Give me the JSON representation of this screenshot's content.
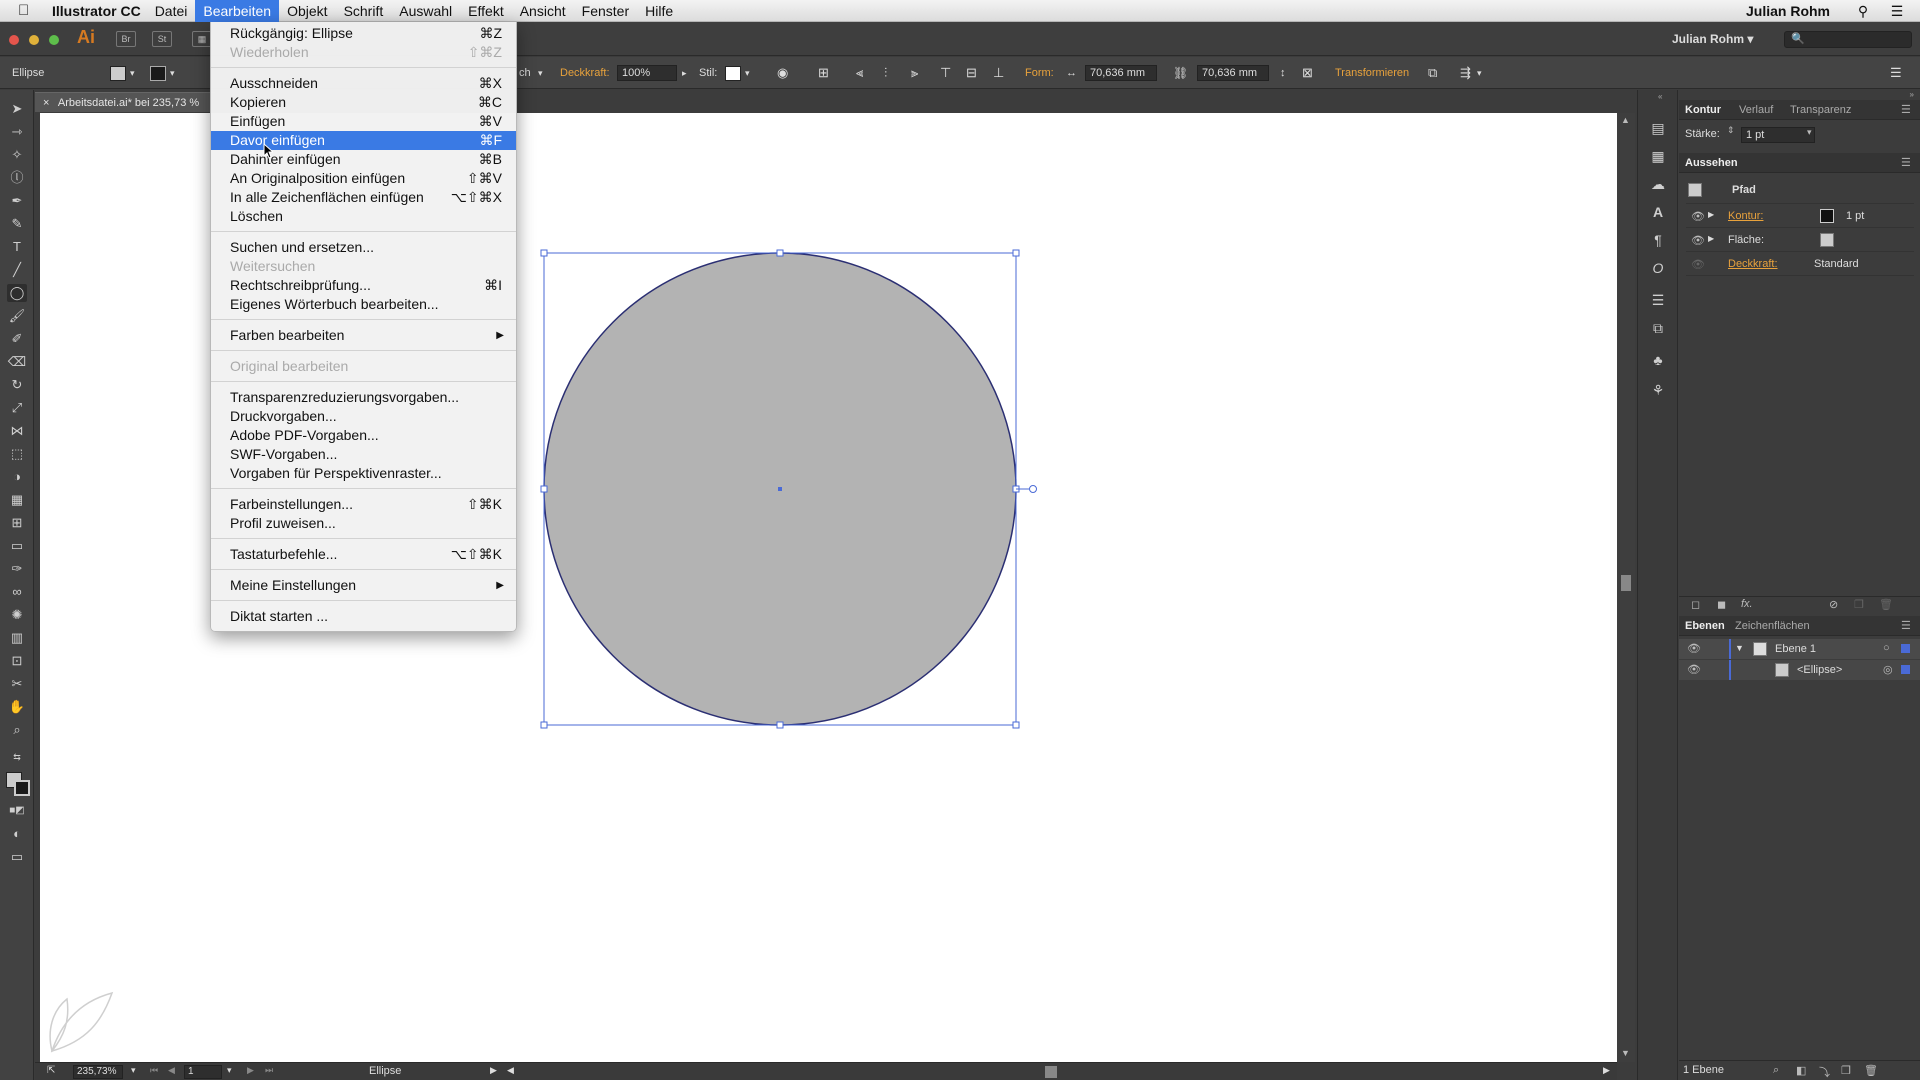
{
  "menubar": {
    "app_name": "Illustrator CC",
    "menus": [
      "Datei",
      "Bearbeiten",
      "Objekt",
      "Schrift",
      "Auswahl",
      "Effekt",
      "Ansicht",
      "Fenster",
      "Hilfe"
    ],
    "active_menu": "Bearbeiten",
    "user": "Julian Rohm"
  },
  "appbar": {
    "logo": "Ai",
    "bridge_labels": [
      "Br",
      "St"
    ],
    "user": "Julian Rohm",
    "user_caret": "▾",
    "search_placeholder": "🔍"
  },
  "controlbar": {
    "selection_label": "Ellipse",
    "partial_label": "ch",
    "opacity_label": "Deckkraft:",
    "opacity_value": "100%",
    "style_label": "Stil:",
    "form_label": "Form:",
    "width_value": "70,636 mm",
    "height_value": "70,636 mm",
    "transform_label": "Transformieren"
  },
  "document": {
    "tab_title": "Arbeitsdatei.ai* bei 235,73 %"
  },
  "dropdown": {
    "items": [
      {
        "label": "Rückgängig: Ellipse",
        "shortcut": "⌘Z",
        "disabled": false
      },
      {
        "label": "Wiederholen",
        "shortcut": "⇧⌘Z",
        "disabled": true
      },
      {
        "label": "Ausschneiden",
        "shortcut": "⌘X",
        "disabled": false
      },
      {
        "label": "Kopieren",
        "shortcut": "⌘C",
        "disabled": false
      },
      {
        "label": "Einfügen",
        "shortcut": "⌘V",
        "disabled": false
      },
      {
        "label": "Davor einfügen",
        "shortcut": "⌘F",
        "disabled": false,
        "highlighted": true
      },
      {
        "label": "Dahinter einfügen",
        "shortcut": "⌘B",
        "disabled": false
      },
      {
        "label": "An Originalposition einfügen",
        "shortcut": "⇧⌘V",
        "disabled": false
      },
      {
        "label": "In alle Zeichenflächen einfügen",
        "shortcut": "⌥⇧⌘X",
        "disabled": false
      },
      {
        "label": "Löschen",
        "shortcut": "",
        "disabled": false
      },
      {
        "label": "Suchen und ersetzen...",
        "shortcut": "",
        "disabled": false
      },
      {
        "label": "Weitersuchen",
        "shortcut": "",
        "disabled": true
      },
      {
        "label": "Rechtschreibprüfung...",
        "shortcut": "⌘I",
        "disabled": false
      },
      {
        "label": "Eigenes Wörterbuch bearbeiten...",
        "shortcut": "",
        "disabled": false
      },
      {
        "label": "Farben bearbeiten",
        "shortcut": "",
        "disabled": false,
        "submenu": true
      },
      {
        "label": "Original bearbeiten",
        "shortcut": "",
        "disabled": true
      },
      {
        "label": "Transparenzreduzierungsvorgaben...",
        "shortcut": "",
        "disabled": false
      },
      {
        "label": "Druckvorgaben...",
        "shortcut": "",
        "disabled": false
      },
      {
        "label": "Adobe PDF-Vorgaben...",
        "shortcut": "",
        "disabled": false
      },
      {
        "label": "SWF-Vorgaben...",
        "shortcut": "",
        "disabled": false
      },
      {
        "label": "Vorgaben für Perspektivenraster...",
        "shortcut": "",
        "disabled": false
      },
      {
        "label": "Farbeinstellungen...",
        "shortcut": "⇧⌘K",
        "disabled": false
      },
      {
        "label": "Profil zuweisen...",
        "shortcut": "",
        "disabled": false
      },
      {
        "label": "Tastaturbefehle...",
        "shortcut": "⌥⇧⌘K",
        "disabled": false
      },
      {
        "label": "Meine Einstellungen",
        "shortcut": "",
        "disabled": false,
        "submenu": true
      },
      {
        "label": "Diktat starten ...",
        "shortcut": "",
        "disabled": false
      }
    ]
  },
  "panels": {
    "top_tabs": [
      "Kontur",
      "Verlauf",
      "Transparenz"
    ],
    "stroke_weight_label": "Stärke:",
    "stroke_weight_value": "1 pt",
    "appearance_title": "Aussehen",
    "appearance_object": "Pfad",
    "appearance_rows": [
      {
        "label": "Kontur:",
        "value": "1 pt"
      },
      {
        "label": "Fläche:",
        "value": ""
      },
      {
        "label": "Deckkraft:",
        "value": "Standard"
      }
    ],
    "layers_tabs": [
      "Ebenen",
      "Zeichenflächen"
    ],
    "layers": [
      {
        "name": "Ebene 1"
      },
      {
        "name": "<Ellipse>"
      }
    ],
    "layers_footer": "1 Ebene"
  },
  "statusbar": {
    "zoom": "235,73%",
    "artboard": "1",
    "status_text": "Ellipse"
  },
  "colors": {
    "ellipse_fill": "#b3b3b3",
    "ellipse_stroke": "#2b2f73",
    "selection": "#4a6ad6",
    "menu_highlight": "#3a7ae4",
    "accent_orange": "#e8a23c"
  }
}
